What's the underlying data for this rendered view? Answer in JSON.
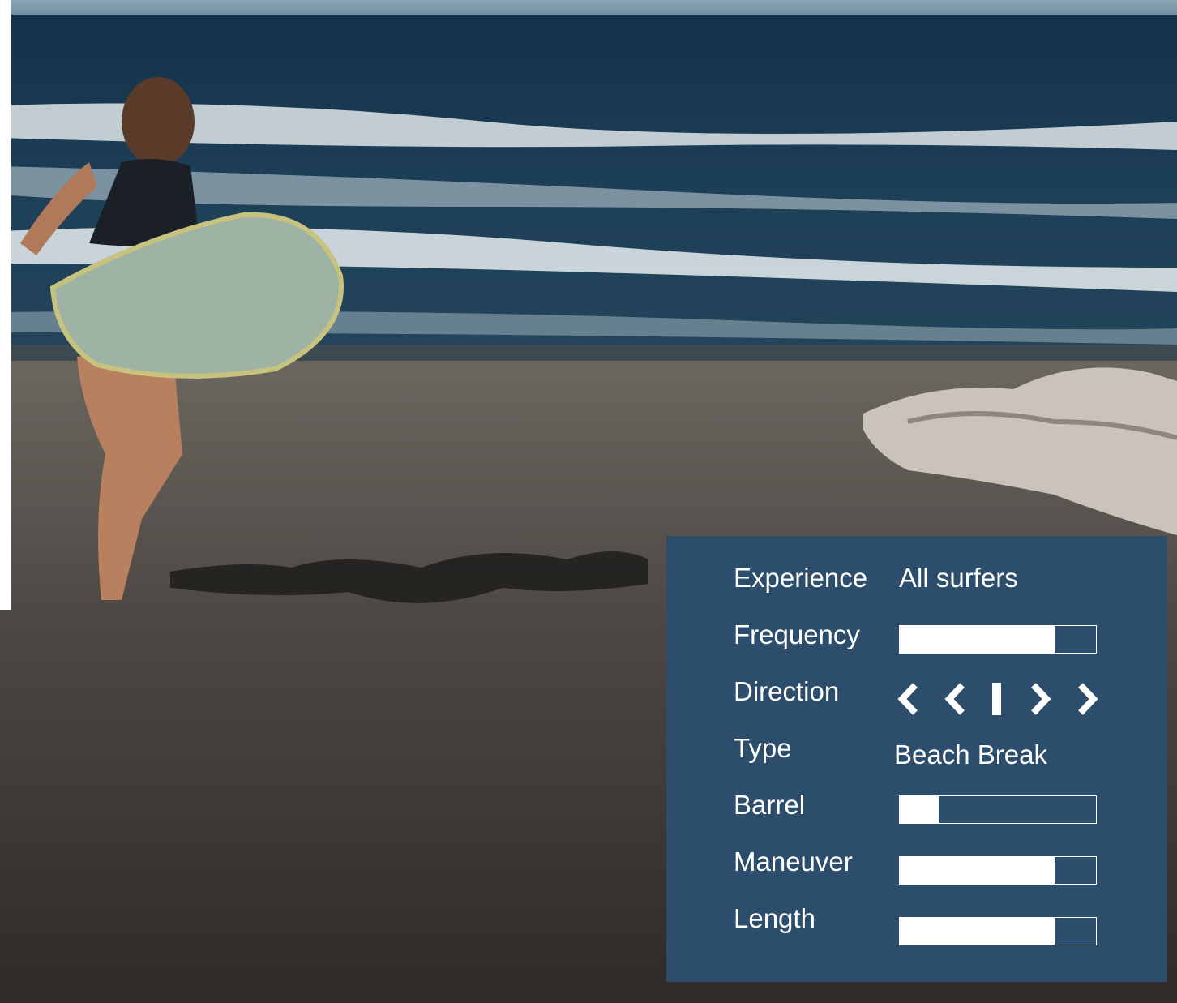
{
  "spot": {
    "rows": [
      {
        "label": "Experience",
        "value": "All surfers"
      },
      {
        "label": "Frequency",
        "level": 0.79
      },
      {
        "label": "Direction",
        "icons": [
          "chevron-left-icon",
          "chevron-left-icon",
          "center-bar-icon",
          "chevron-right-icon",
          "chevron-right-icon"
        ]
      },
      {
        "label": "Type",
        "value": "Beach Break"
      },
      {
        "label": "Barrel",
        "level": 0.2
      },
      {
        "label": "Maneuver",
        "level": 0.79
      },
      {
        "label": "Length",
        "level": 0.79
      }
    ]
  },
  "colors": {
    "card_background": "#2c4d6c",
    "text": "#ffffff",
    "bar_fill": "#ffffff"
  }
}
